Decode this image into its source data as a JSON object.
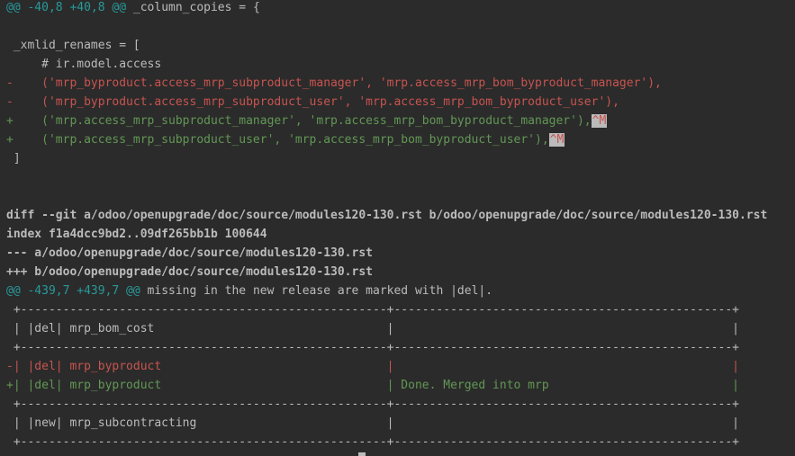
{
  "lines": [
    {
      "kind": "hunk",
      "text": "@@ -40,8 +40,8 @@",
      "suffix": " _column_copies = {"
    },
    {
      "kind": "ctx",
      "text": ""
    },
    {
      "kind": "ctx",
      "text": " _xmlid_renames = ["
    },
    {
      "kind": "ctx",
      "text": "     # ir.model.access"
    },
    {
      "kind": "del",
      "text": "-    ('mrp_byproduct.access_mrp_subproduct_manager', 'mrp.access_mrp_bom_byproduct_manager'),"
    },
    {
      "kind": "del",
      "text": "-    ('mrp_byproduct.access_mrp_subproduct_user', 'mrp.access_mrp_bom_byproduct_user'),"
    },
    {
      "kind": "add",
      "text": "+    ('mrp.access_mrp_subproduct_manager', 'mrp.access_mrp_bom_byproduct_manager'),",
      "cr": "^M"
    },
    {
      "kind": "add",
      "text": "+    ('mrp.access_mrp_subproduct_user', 'mrp.access_mrp_bom_byproduct_user'),",
      "cr": "^M"
    },
    {
      "kind": "ctx",
      "text": " ]"
    },
    {
      "kind": "ctx",
      "text": ""
    },
    {
      "kind": "ctx",
      "text": ""
    },
    {
      "kind": "hdr",
      "text": "diff --git a/odoo/openupgrade/doc/source/modules120-130.rst b/odoo/openupgrade/doc/source/modules120-130.rst"
    },
    {
      "kind": "hdr",
      "text": "index f1a4dcc9bd2..09df265bb1b 100644"
    },
    {
      "kind": "hdr",
      "text": "--- a/odoo/openupgrade/doc/source/modules120-130.rst"
    },
    {
      "kind": "hdr",
      "text": "+++ b/odoo/openupgrade/doc/source/modules120-130.rst"
    },
    {
      "kind": "hunk",
      "text": "@@ -439,7 +439,7 @@",
      "suffix": " missing in the new release are marked with |del|."
    },
    {
      "kind": "ctx",
      "text": " +----------------------------------------------------+------------------------------------------------+"
    },
    {
      "kind": "ctx",
      "text": " | |del| mrp_bom_cost                                 |                                                |"
    },
    {
      "kind": "ctx",
      "text": " +----------------------------------------------------+------------------------------------------------+"
    },
    {
      "kind": "del",
      "text": "-| |del| mrp_byproduct                                |                                                |"
    },
    {
      "kind": "add",
      "text": "+| |del| mrp_byproduct                                | Done. Merged into mrp                          |"
    },
    {
      "kind": "ctx",
      "text": " +----------------------------------------------------+------------------------------------------------+"
    },
    {
      "kind": "ctx",
      "text": " | |new| mrp_subcontracting                           |                                                |"
    },
    {
      "kind": "ctx",
      "text": " +----------------------------------------------------+------------------------------------------------+"
    }
  ]
}
